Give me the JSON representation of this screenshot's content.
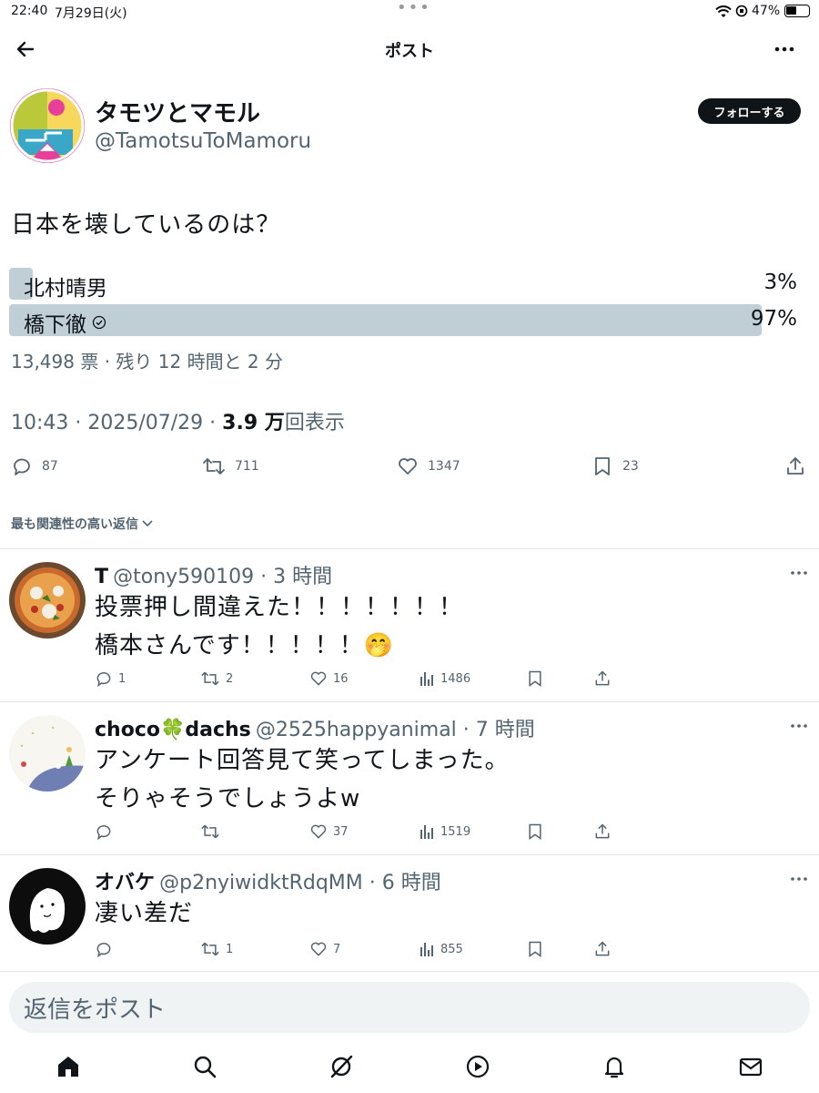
{
  "status_bar": {
    "time": "22:40",
    "date": "7月29日(火)",
    "battery": "47%"
  },
  "header": {
    "title": "ポスト"
  },
  "post": {
    "display_name": "タモツとマモル",
    "handle": "@TamotsuToMamoru",
    "follow_label": "フォローする",
    "text": "日本を壊しているのは？",
    "poll": {
      "options": [
        {
          "label": "北村晴男",
          "percent": "3%",
          "value": 3
        },
        {
          "label": "橋下徹",
          "percent": "97%",
          "value": 97
        }
      ],
      "summary": "13,498 票 · 残り 12 時間と 2 分"
    },
    "meta": {
      "time_date": "10:43 · 2025/07/29 · ",
      "views_bold": "3.9 万",
      "views_suffix": "回表示"
    },
    "actions": {
      "replies": "87",
      "reposts": "711",
      "likes": "1347",
      "bookmarks": "23"
    }
  },
  "sort_label": "最も関連性の高い返信",
  "replies": [
    {
      "name": "T",
      "handle_time": "@tony590109 · 3 時間",
      "lines": [
        "投票押し間違えた！！！！！！！",
        "橋本さんです！！！！！🤭"
      ],
      "replies": "1",
      "reposts": "2",
      "likes": "16",
      "views": "1486"
    },
    {
      "name": "choco🍀dachs",
      "handle_time": "@2525happyanimal · 7 時間",
      "lines": [
        "アンケート回答見て笑ってしまった。",
        "そりゃそうでしょうよw"
      ],
      "replies": "",
      "reposts": "",
      "likes": "37",
      "views": "1519"
    },
    {
      "name": "オバケ",
      "handle_time": "@p2nyiwidktRdqMM · 6 時間",
      "lines": [
        "凄い差だ"
      ],
      "replies": "",
      "reposts": "1",
      "likes": "7",
      "views": "855"
    }
  ],
  "composer": {
    "placeholder": "返信をポスト"
  },
  "icons": {
    "back": "arrow-left-icon",
    "more": "more-horizontal-icon",
    "tabs": [
      "home-icon",
      "search-icon",
      "grok-icon",
      "video-icon",
      "notifications-icon",
      "messages-icon"
    ]
  }
}
